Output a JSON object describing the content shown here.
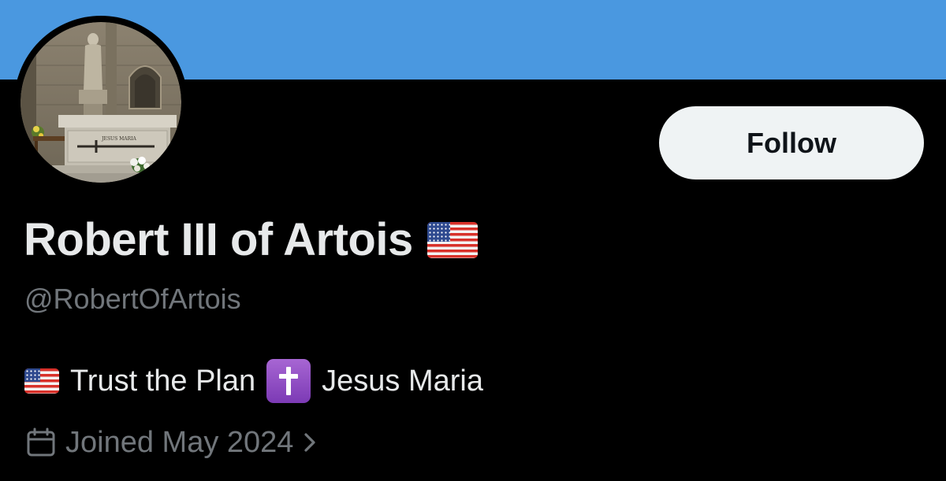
{
  "profile": {
    "display_name": "Robert III of Artois",
    "handle": "@RobertOfArtois",
    "name_emoji_icon": "us-flag-icon",
    "bio": {
      "flag_icon": "us-flag-icon",
      "text_1": "Trust the Plan",
      "cross_icon": "latin-cross-emoji-icon",
      "text_2": "Jesus Maria"
    },
    "joined": {
      "icon": "calendar-icon",
      "text": "Joined May 2024",
      "chevron_icon": "chevron-right-icon"
    },
    "avatar": {
      "icon": "avatar-photo-church-altar",
      "carved_text": "JESUS MARIA"
    }
  },
  "actions": {
    "follow_label": "Follow"
  },
  "colors": {
    "banner": "#4a98e0",
    "background": "#000000",
    "primary_text": "#e7e9ea",
    "secondary_text": "#71767b",
    "follow_button_bg": "#eff3f4",
    "follow_button_text": "#0f1419"
  }
}
